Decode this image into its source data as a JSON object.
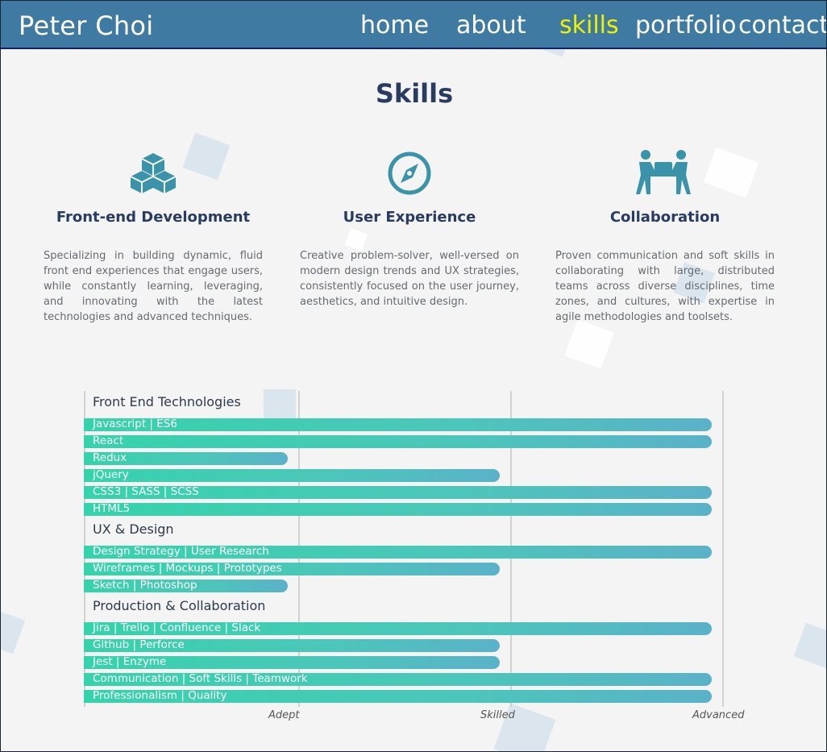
{
  "header": {
    "brand": "Peter Choi",
    "nav": [
      {
        "label": "home",
        "active": false
      },
      {
        "label": "about",
        "active": false
      },
      {
        "label": "skills",
        "active": true
      },
      {
        "label": "portfolio",
        "active": false
      },
      {
        "label": "contact",
        "active": false
      }
    ]
  },
  "page_title": "Skills",
  "colors": {
    "header_bg": "#3e7aa1",
    "active_nav": "#eef200",
    "accent": "#3a93a8",
    "bar_start": "#35d3ab",
    "bar_end": "#5ab2c8"
  },
  "columns": [
    {
      "icon": "cubes-icon",
      "title": "Front-end Development",
      "text": "Specializing in building dynamic, fluid front end experiences that engage users, while constantly learning, leveraging, and innovating with the latest technologies and advanced techniques."
    },
    {
      "icon": "compass-icon",
      "title": "User Experience",
      "text": "Creative problem-solver, well-versed on modern design trends and UX strategies, consistently focused on the user journey, aesthetics, and intuitive design."
    },
    {
      "icon": "people-carry-icon",
      "title": "Collaboration",
      "text": "Proven communication and soft skills in collaborating with large, distributed teams across diverse disciplines, time zones, and cultures, with expertise in agile methodologies and toolsets."
    }
  ],
  "chart_data": {
    "type": "bar",
    "orientation": "horizontal",
    "scale_labels": [
      "Adept",
      "Skilled",
      "Advanced"
    ],
    "max": 3,
    "groups": [
      {
        "name": "Front End Technologies",
        "items": [
          {
            "label": "Javascript | ES6",
            "value": 3
          },
          {
            "label": "React",
            "value": 3
          },
          {
            "label": "Redux",
            "value": 1
          },
          {
            "label": "jQuery",
            "value": 2
          },
          {
            "label": "CSS3 | SASS | SCSS",
            "value": 3
          },
          {
            "label": "HTML5",
            "value": 3
          }
        ]
      },
      {
        "name": "UX & Design",
        "items": [
          {
            "label": "Design Strategy | User Research",
            "value": 3
          },
          {
            "label": "Wireframes | Mockups | Prototypes",
            "value": 2
          },
          {
            "label": "Sketch | Photoshop",
            "value": 1
          }
        ]
      },
      {
        "name": "Production & Collaboration",
        "items": [
          {
            "label": "Jira | Trello | Confluence | Slack",
            "value": 3
          },
          {
            "label": "Github | Perforce",
            "value": 2
          },
          {
            "label": "Jest | Enzyme",
            "value": 2
          },
          {
            "label": "Communication | Soft Skills | Teamwork",
            "value": 3
          },
          {
            "label": "Professionalism | Quality",
            "value": 3
          }
        ]
      }
    ]
  }
}
